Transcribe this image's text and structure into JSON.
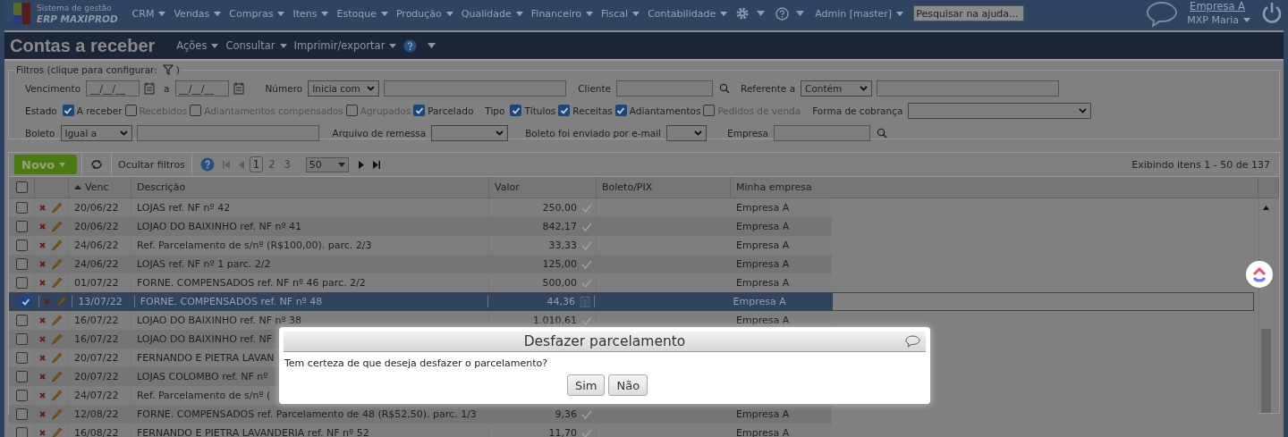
{
  "nav": {
    "logo_top": "Sistema de gestão",
    "logo_bottom": "ERP MAXIPROD",
    "menus": [
      "CRM",
      "Vendas",
      "Compras",
      "Itens",
      "Estoque",
      "Produção",
      "Qualidade",
      "Financeiro",
      "Fiscal",
      "Contabilidade"
    ],
    "user": "Admin [master]",
    "search": {
      "placeholder": "Pesquisar na ajuda..."
    },
    "company": "Empresa A",
    "account": "MXP Maria"
  },
  "page": {
    "title": "Contas a receber",
    "actions": [
      "Ações",
      "Consultar",
      "Imprimir/exportar"
    ]
  },
  "filters": {
    "legend": "Filtros (clique para configurar:",
    "legend_end": ")",
    "vencimento": {
      "label": "Vencimento",
      "from": "__/__/__",
      "sep": "a",
      "to": "__/__/__"
    },
    "numero": {
      "label": "Número",
      "operator": "Inicia com"
    },
    "cliente": {
      "label": "Cliente"
    },
    "referente": {
      "label": "Referente a",
      "operator": "Contém"
    },
    "estado": {
      "label": "Estado",
      "options": [
        {
          "label": "A receber",
          "checked": true
        },
        {
          "label": "Recebidos",
          "checked": false
        },
        {
          "label": "Adiantamentos compensados",
          "checked": false
        },
        {
          "label": "Agrupados",
          "checked": false
        },
        {
          "label": "Parcelado",
          "checked": true
        }
      ]
    },
    "tipo": {
      "label": "Tipo",
      "options": [
        {
          "label": "Títulos",
          "checked": true
        },
        {
          "label": "Receitas",
          "checked": true
        },
        {
          "label": "Adiantamentos",
          "checked": true
        },
        {
          "label": "Pedidos de venda",
          "checked": false
        }
      ]
    },
    "forma_cobranca": {
      "label": "Forma de cobrança"
    },
    "boleto": {
      "label": "Boleto",
      "operator": "Igual a"
    },
    "arquivo_remessa": {
      "label": "Arquivo de remessa"
    },
    "boleto_email": {
      "label": "Boleto foi enviado por e-mail"
    },
    "empresa": {
      "label": "Empresa"
    }
  },
  "toolbar": {
    "new_button": "Novo",
    "hide_filters": "Ocultar filtros",
    "pages": [
      {
        "label": "1",
        "selected": true
      },
      {
        "label": "2",
        "selected": false
      },
      {
        "label": "3",
        "selected": false
      }
    ],
    "page_size": "50",
    "summary": "Exibindo itens 1 - 50 de 137"
  },
  "table": {
    "select_all_checked": false,
    "columns": [
      "Venc",
      "Descrição",
      "Valor",
      "Boleto/PIX",
      "Minha empresa"
    ],
    "rows": [
      {
        "selected": false,
        "venc": "20/06/22",
        "descricao": "LOJAS ref. NF nº 42",
        "valor": "250,00",
        "kind": "paid",
        "empresa": "Empresa A"
      },
      {
        "selected": false,
        "venc": "20/06/22",
        "descricao": "LOJAO DO BAIXINHO ref. NF nº 41",
        "valor": "842,17",
        "kind": "paid",
        "empresa": "Empresa A"
      },
      {
        "selected": false,
        "venc": "24/06/22",
        "descricao": "Ref. Parcelamento de s/nº (R$100,00). parc. 2/3",
        "valor": "33,33",
        "kind": "paid",
        "empresa": "Empresa A"
      },
      {
        "selected": false,
        "venc": "24/06/22",
        "descricao": "LOJAS ref. NF nº 1 parc. 2/2",
        "valor": "125,00",
        "kind": "paid",
        "empresa": "Empresa A"
      },
      {
        "selected": false,
        "venc": "01/07/22",
        "descricao": "FORNE. COMPENSADOS ref. NF nº 46 parc. 2/2",
        "valor": "500,00",
        "kind": "paid",
        "empresa": "Empresa A"
      },
      {
        "selected": true,
        "venc": "13/07/22",
        "descricao": "FORNE. COMPENSADOS ref. NF nº 48",
        "valor": "44,36",
        "kind": "boleto",
        "empresa": "Empresa A"
      },
      {
        "selected": false,
        "venc": "16/07/22",
        "descricao": "LOJAO DO BAIXINHO ref. NF nº 38",
        "valor": "1.010,61",
        "kind": "paid",
        "empresa": "Empresa A"
      },
      {
        "selected": false,
        "venc": "16/07/22",
        "descricao": "LOJAO DO BAIXINHO ref. NF"
      },
      {
        "selected": false,
        "venc": "20/07/22",
        "descricao": "FERNANDO E PIETRA LAVAN"
      },
      {
        "selected": false,
        "venc": "20/07/22",
        "descricao": "LOJAS COLOMBO ref. NF nº"
      },
      {
        "selected": false,
        "venc": "24/07/22",
        "descricao": "Ref. Parcelamento de s/nº ("
      },
      {
        "selected": false,
        "venc": "12/08/22",
        "descricao": "FORNE. COMPENSADOS ref. Parcelamento de 48 (R$52,50). parc. 1/3",
        "valor": "9,36",
        "kind": "paid",
        "empresa": "Empresa A"
      },
      {
        "selected": false,
        "venc": "16/08/22",
        "descricao": "FERNANDO E PIETRA LAVANDERIA ref. NF nº 52",
        "valor": "11,70",
        "kind": "paid",
        "empresa": "Empresa A"
      }
    ]
  },
  "dialog": {
    "title": "Desfazer parcelamento",
    "message": "Tem certeza de que deseja desfazer o parcelamento?",
    "buttons": [
      "Sim",
      "Não"
    ]
  }
}
